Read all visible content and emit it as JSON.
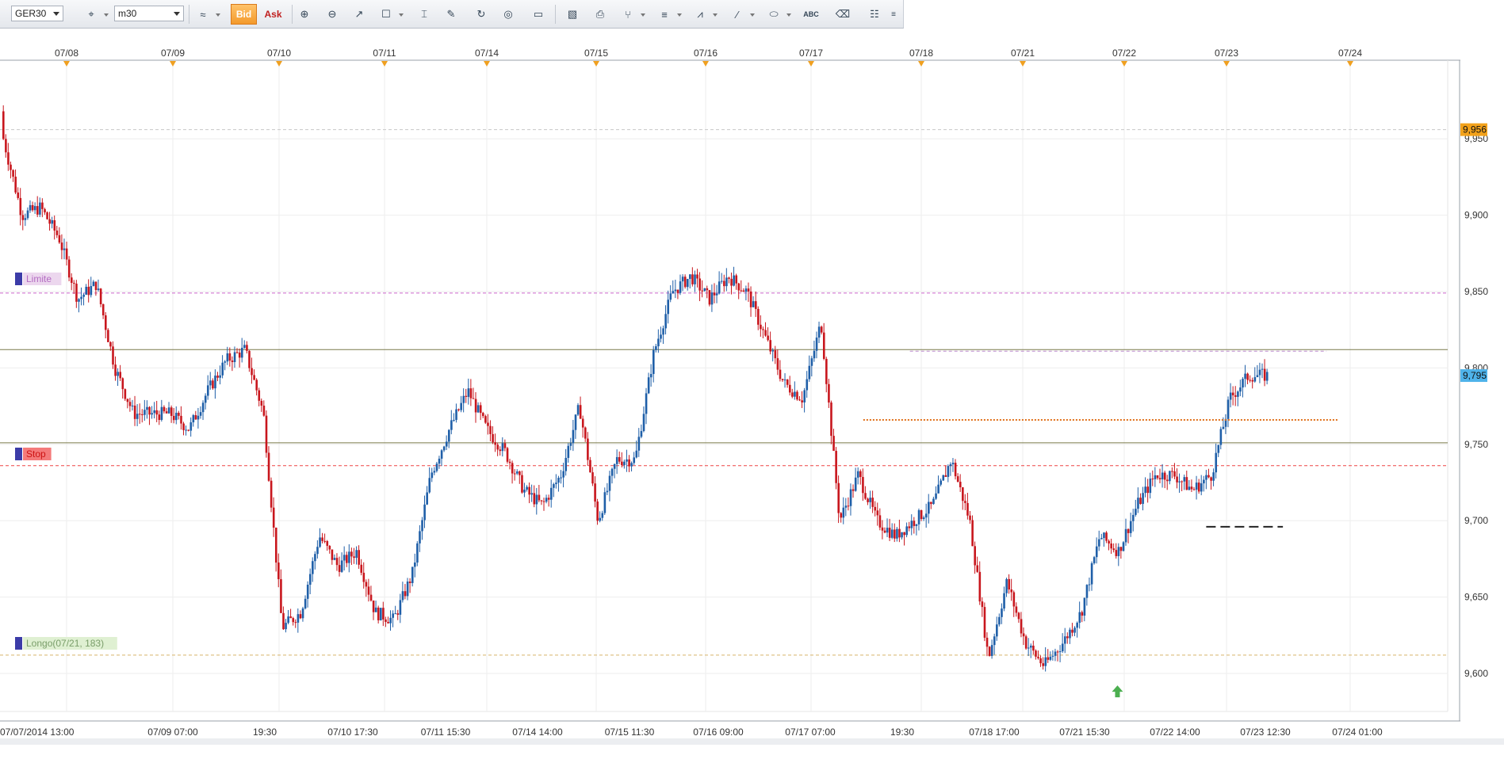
{
  "toolbar": {
    "symbol": "GER30",
    "timeframe": "m30",
    "bid_label": "Bid",
    "ask_label": "Ask",
    "icons": [
      "crosshair-icon",
      "zoom-in-icon",
      "zoom-out-icon",
      "cursor-icon",
      "zoom-area-icon",
      "vertical-line-icon",
      "indicator-icon",
      "rotate-icon",
      "globe-icon",
      "ruler-icon",
      "image-icon",
      "print-icon",
      "fork-icon",
      "horizontal-lines-icon",
      "fan-icon",
      "trend-line-icon",
      "ellipse-icon",
      "text-abc-icon",
      "eraser-icon",
      "tree-icon",
      "more-icon"
    ]
  },
  "chart_data": {
    "type": "candlestick",
    "symbol": "GER30",
    "timeframe": "m30",
    "ylim": [
      9590,
      9975
    ],
    "y_ticks": [
      "9,600",
      "9,650",
      "9,700",
      "9,750",
      "9,800",
      "9,850",
      "9,900",
      "9,950"
    ],
    "top_axis_labels": [
      "07/08",
      "07/09",
      "07/10",
      "07/11",
      "07/14",
      "07/15",
      "07/16",
      "07/17",
      "07/18",
      "07/21",
      "07/22",
      "07/23",
      "07/24"
    ],
    "bottom_axis_labels": [
      "07/07/2014 13:00",
      "07/09 07:00",
      "19:30",
      "07/10 17:30",
      "07/11 15:30",
      "07/14 14:00",
      "07/15 11:30",
      "07/16 09:00",
      "07/17 07:00",
      "19:30",
      "07/18 17:00",
      "07/21 15:30",
      "07/22 14:00",
      "07/23 12:30",
      "07/24 01:00"
    ],
    "price_tags": [
      {
        "text": "9,956",
        "value": 9956,
        "color": "#f3a21b"
      },
      {
        "text": "9,795",
        "value": 9795,
        "color": "#4fb3ea"
      }
    ],
    "colors": {
      "up": "#1f5fa8",
      "down": "#c8161d",
      "limit": "#cc66cc",
      "stop": "#ee4444",
      "longo": "#d8b46a",
      "support": "#7a7a4a"
    },
    "levels": [
      {
        "label": "Limite",
        "value": 9849
      },
      {
        "label": "Stop",
        "value": 9736
      },
      {
        "label": "Longo(07/21, 183)",
        "value": 9612
      }
    ],
    "support_lines": [
      9812,
      9751
    ],
    "waypoints": [
      [
        9968,
        9950
      ],
      [
        9935,
        9900
      ],
      [
        9910,
        9905
      ],
      [
        9925,
        9885
      ],
      [
        9905,
        9845
      ],
      [
        9860,
        9855
      ],
      [
        9845,
        9800
      ],
      [
        9780,
        9770
      ],
      [
        9790,
        9770
      ],
      [
        9775,
        9770
      ],
      [
        9780,
        9760
      ],
      [
        9790,
        9785
      ],
      [
        9810,
        9805
      ],
      [
        9815,
        9812
      ],
      [
        9790,
        9770
      ],
      [
        9680,
        9630
      ],
      [
        9620,
        9640
      ],
      [
        9660,
        9690
      ],
      [
        9680,
        9670
      ],
      [
        9690,
        9680
      ],
      [
        9650,
        9640
      ],
      [
        9640,
        9635
      ],
      [
        9650,
        9665
      ],
      [
        9720,
        9730
      ],
      [
        9750,
        9760
      ],
      [
        9780,
        9785
      ],
      [
        9780,
        9760
      ],
      [
        9760,
        9745
      ],
      [
        9740,
        9720
      ],
      [
        9725,
        9710
      ],
      [
        9740,
        9730
      ],
      [
        9760,
        9775
      ],
      [
        9755,
        9700
      ],
      [
        9745,
        9740
      ],
      [
        9760,
        9740
      ],
      [
        9800,
        9810
      ],
      [
        9840,
        9850
      ],
      [
        9860,
        9860
      ],
      [
        9840,
        9845
      ],
      [
        9870,
        9860
      ],
      [
        9860,
        9850
      ],
      [
        9835,
        9820
      ],
      [
        9810,
        9790
      ],
      [
        9745,
        9780
      ],
      [
        9805,
        9830
      ],
      [
        9745,
        9700
      ],
      [
        9720,
        9730
      ],
      [
        9690,
        9700
      ],
      [
        9665,
        9690
      ],
      [
        9680,
        9700
      ],
      [
        9690,
        9710
      ],
      [
        9730,
        9740
      ],
      [
        9725,
        9700
      ],
      [
        9630,
        9610
      ],
      [
        9640,
        9660
      ],
      [
        9630,
        9620
      ],
      [
        9615,
        9605
      ],
      [
        9610,
        9620
      ],
      [
        9635,
        9640
      ],
      [
        9650,
        9690
      ],
      [
        9660,
        9680
      ],
      [
        9700,
        9710
      ],
      [
        9725,
        9730
      ],
      [
        9735,
        9730
      ],
      [
        9725,
        9720
      ],
      [
        9705,
        9730
      ],
      [
        9790,
        9780
      ],
      [
        9785,
        9795
      ],
      [
        9795,
        9795
      ]
    ],
    "annotations": [
      {
        "type": "hline",
        "color": "#bb88cc",
        "value": 9811,
        "style": "dashed",
        "from": 0.605,
        "to": 0.882
      },
      {
        "type": "hline",
        "color": "#e0701a",
        "value": 9766,
        "style": "dotted",
        "from": 0.574,
        "to": 0.89
      },
      {
        "type": "hline",
        "color": "#222222",
        "value": 9696,
        "style": "dashed-bold",
        "from": 0.802,
        "to": 0.853
      },
      {
        "type": "arrow",
        "color": "#4caf50",
        "value": 9588,
        "at": 0.743
      }
    ],
    "title": "",
    "xlabel": "",
    "ylabel": ""
  }
}
